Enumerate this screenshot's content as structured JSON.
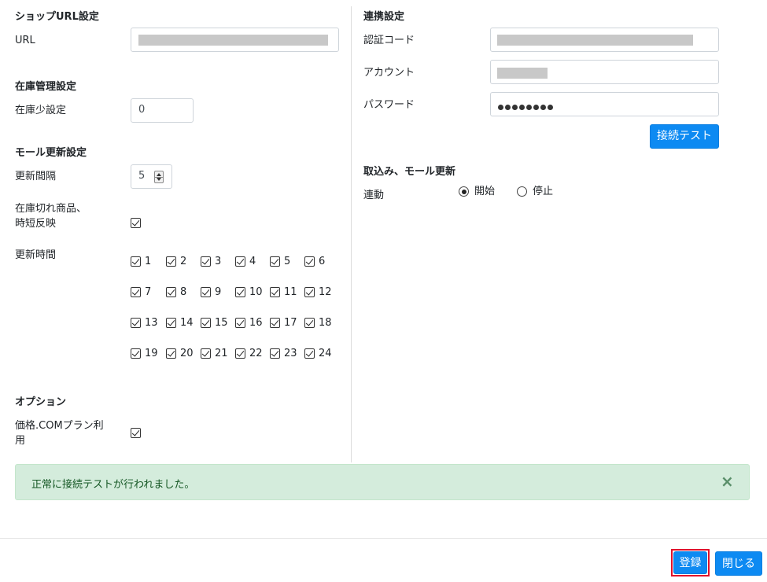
{
  "shop_url": {
    "title": "ショップURL設定",
    "url_label": "URL"
  },
  "inventory": {
    "title": "在庫管理設定",
    "low_label": "在庫少設定",
    "low_value": "0"
  },
  "mall_update": {
    "title": "モール更新設定",
    "interval_label": "更新間隔",
    "interval_value": "5",
    "outofstock_label_line1": "在庫切れ商品、",
    "outofstock_label_line2": "時短反映",
    "update_time_label": "更新時間",
    "hours": [
      "1",
      "2",
      "3",
      "4",
      "5",
      "6",
      "7",
      "8",
      "9",
      "10",
      "11",
      "12",
      "13",
      "14",
      "15",
      "16",
      "17",
      "18",
      "19",
      "20",
      "21",
      "22",
      "23",
      "24"
    ]
  },
  "options": {
    "title": "オプション",
    "kakaku_label_line1": "価格.COMプラン利",
    "kakaku_label_line2": "用"
  },
  "integration": {
    "title": "連携設定",
    "auth_code_label": "認証コード",
    "account_label": "アカウント",
    "password_label": "パスワード",
    "test_button": "接続テスト"
  },
  "import_update": {
    "title": "取込み、モール更新",
    "link_label": "連動",
    "option_start": "開始",
    "option_stop": "停止"
  },
  "alert": {
    "message": "正常に接続テストが行われました。",
    "close_symbol": "×"
  },
  "footer": {
    "register_button": "登録",
    "close_button": "閉じる"
  },
  "colors": {
    "primary": "#0d8af2",
    "alert_bg": "#d4ecdc",
    "alert_text": "#155724",
    "highlight_border": "#e0112b"
  }
}
